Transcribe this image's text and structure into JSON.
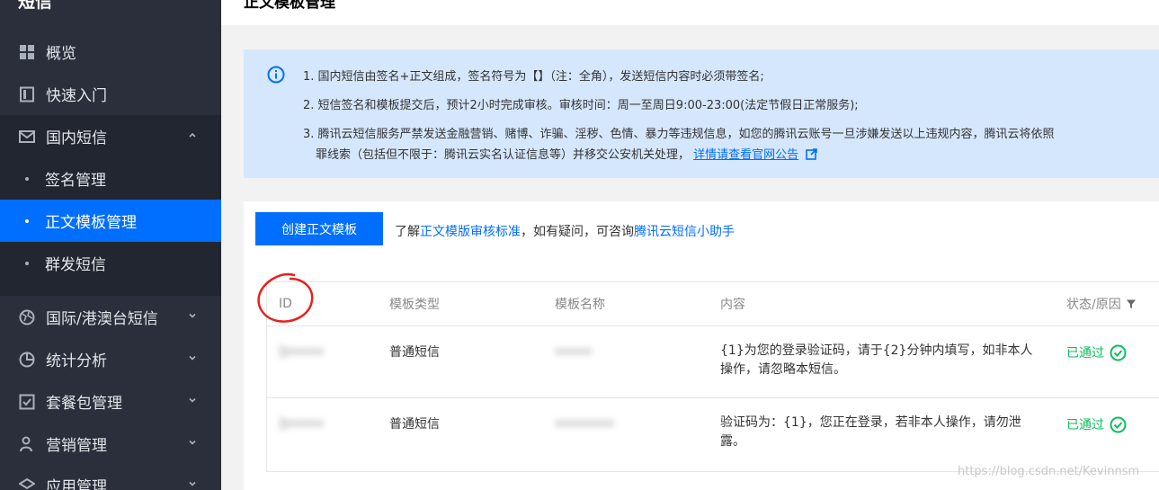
{
  "sidebar": {
    "title": "短信",
    "items": [
      {
        "label": "概览"
      },
      {
        "label": "快速入门"
      },
      {
        "label": "国内短信"
      },
      {
        "label": "国际/港澳台短信"
      },
      {
        "label": "统计分析"
      },
      {
        "label": "套餐包管理"
      },
      {
        "label": "营销管理"
      },
      {
        "label": "应用管理"
      }
    ],
    "sub_items": [
      {
        "label": "签名管理"
      },
      {
        "label": "正文模板管理",
        "active": true
      },
      {
        "label": "群发短信"
      }
    ]
  },
  "header": {
    "title": "正文模板管理"
  },
  "notice": {
    "lines": [
      "1. 国内短信由签名+正文组成，签名符号为【】（注：全角），发送短信内容时必须带签名;",
      "2. 短信签名和模板提交后，预计2小时完成审核。审核时间：周一至周日9:00-23:00(法定节假日正常服务);",
      "3. 腾讯云短信服务严禁发送金融营销、赌博、诈骗、淫秽、色情、暴力等违规信息，如您的腾讯云账号一旦涉嫌发送以上违规内容，腾讯云将依照"
    ],
    "line4_prefix": "罪线索（包括但不限于：腾讯云实名认证信息等）并移交公安机关处理，",
    "line4_link": "详情请查看官网公告"
  },
  "toolbar": {
    "create_label": "创建正文模板",
    "help_prefix": "了解",
    "help_link1": "正文模版审核标准",
    "help_mid": "，如有疑问，可咨询",
    "help_link2": "腾讯云短信小助手"
  },
  "table": {
    "headers": [
      "ID",
      "模板类型",
      "模板名称",
      "内容",
      "状态/原因"
    ],
    "rows": [
      {
        "id": "1•••••",
        "type": "普通短信",
        "name": "•••••",
        "content_line1": "{1}为您的登录验证码，请于{2}分钟内填写，如非本人",
        "content_line2": "操作，请忽略本短信。",
        "status": "已通过"
      },
      {
        "id": "1•••••",
        "type": "普通短信",
        "name": "••••••••",
        "content_line1": "验证码为：{1}，您正在登录，若非本人操作，请勿泄",
        "content_line2": "露。",
        "status": "已通过"
      }
    ]
  },
  "watermark": "https://blog.csdn.net/Kevinnsm",
  "colors": {
    "sidebar_bg": "#2a2f3b",
    "accent": "#006eff",
    "success": "#0abf5b",
    "notice_bg": "#d5e7fd",
    "annotation": "#e8201e"
  }
}
